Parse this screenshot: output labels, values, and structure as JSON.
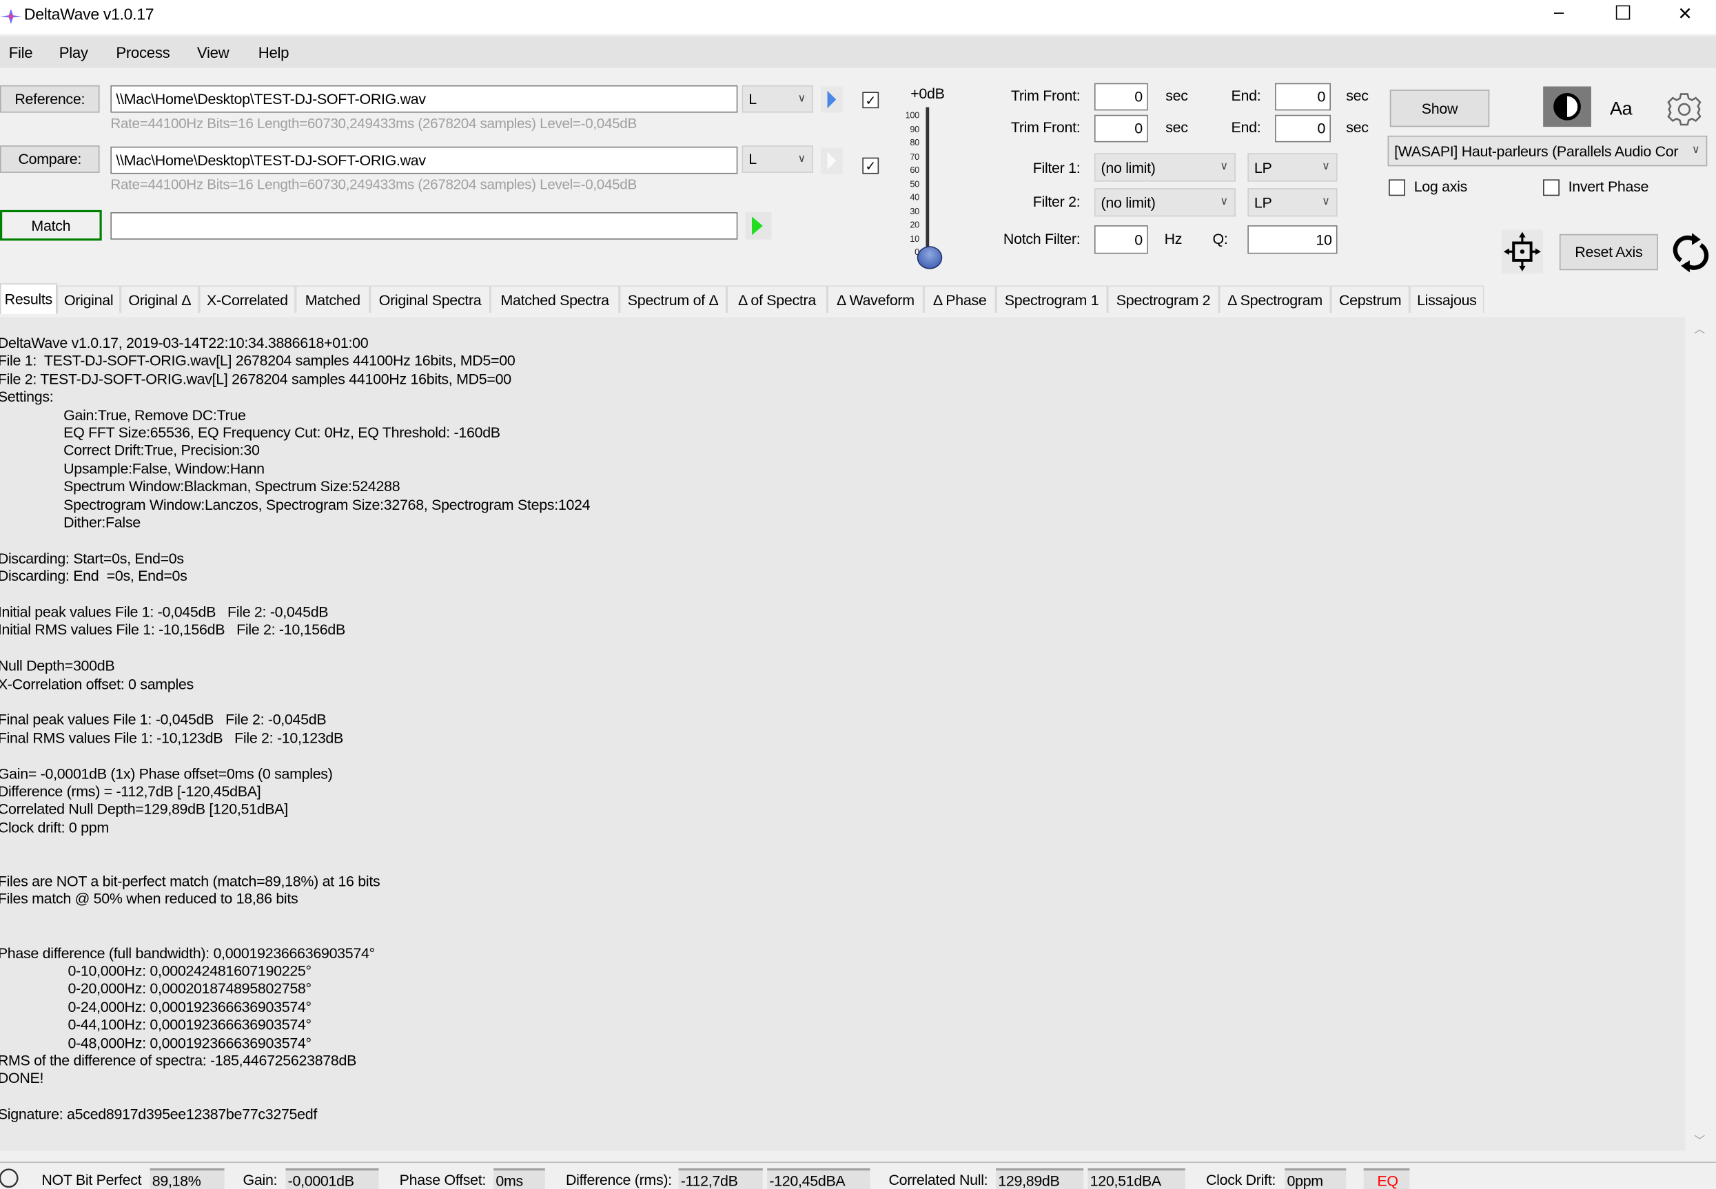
{
  "window": {
    "title": "DeltaWave v1.0.17",
    "minimize": "–",
    "maximize": "☐",
    "close": "✕"
  },
  "menu": [
    "File",
    "Play",
    "Process",
    "View",
    "Help"
  ],
  "reference": {
    "button": "Reference:",
    "path": "\\\\Mac\\Home\\Desktop\\TEST-DJ-SOFT-ORIG.wav",
    "channel": "L",
    "info": "Rate=44100Hz Bits=16 Length=60730,249433ms (2678204 samples) Level=-0,045dB",
    "checked": true
  },
  "compare": {
    "button": "Compare:",
    "path": "\\\\Mac\\Home\\Desktop\\TEST-DJ-SOFT-ORIG.wav",
    "channel": "L",
    "info": "Rate=44100Hz Bits=16 Length=60730,249433ms (2678204 samples) Level=-0,045dB",
    "checked": true
  },
  "match": {
    "button": "Match",
    "value": ""
  },
  "level": {
    "label": "+0dB",
    "ticks": [
      "100",
      "90",
      "80",
      "70",
      "60",
      "50",
      "40",
      "30",
      "20",
      "10",
      "0"
    ],
    "value": 0
  },
  "trim": [
    {
      "front_label": "Trim Front:",
      "front": "0",
      "unit": "sec",
      "end_label": "End:",
      "end": "0",
      "end_unit": "sec"
    },
    {
      "front_label": "Trim Front:",
      "front": "0",
      "unit": "sec",
      "end_label": "End:",
      "end": "0",
      "end_unit": "sec"
    }
  ],
  "filters": [
    {
      "label": "Filter 1:",
      "value": "(no limit)",
      "type": "LP"
    },
    {
      "label": "Filter 2:",
      "value": "(no limit)",
      "type": "LP"
    }
  ],
  "notch": {
    "label": "Notch Filter:",
    "value": "0",
    "unit": "Hz",
    "q_label": "Q:",
    "q": "10"
  },
  "right": {
    "show": "Show",
    "font": "Aa",
    "device": "[WASAPI] Haut-parleurs (Parallels Audio Cor",
    "log_axis": "Log axis",
    "invert_phase": "Invert Phase",
    "reset_axis": "Reset Axis"
  },
  "tabs": [
    "Results",
    "Original",
    "Original Δ",
    "X-Correlated",
    "Matched",
    "Original Spectra",
    "Matched Spectra",
    "Spectrum of Δ",
    "Δ of Spectra",
    "Δ Waveform",
    "Δ Phase",
    "Spectrogram 1",
    "Spectrogram 2",
    "Δ Spectrogram",
    "Cepstrum",
    "Lissajous"
  ],
  "results": [
    {
      "t": "DeltaWave v1.0.17, 2019-03-14T22:10:34.3886618+01:00",
      "i": 0
    },
    {
      "t": "File 1:  TEST-DJ-SOFT-ORIG.wav[L] 2678204 samples 44100Hz 16bits, MD5=00",
      "i": 0
    },
    {
      "t": "File 2: TEST-DJ-SOFT-ORIG.wav[L] 2678204 samples 44100Hz 16bits, MD5=00",
      "i": 0
    },
    {
      "t": "Settings:",
      "i": 0
    },
    {
      "t": "Gain:True, Remove DC:True",
      "i": 1
    },
    {
      "t": "EQ FFT Size:65536, EQ Frequency Cut: 0Hz, EQ Threshold: -160dB",
      "i": 1
    },
    {
      "t": "Correct Drift:True, Precision:30",
      "i": 1
    },
    {
      "t": "Upsample:False, Window:Hann",
      "i": 1
    },
    {
      "t": "Spectrum Window:Blackman, Spectrum Size:524288",
      "i": 1
    },
    {
      "t": "Spectrogram Window:Lanczos, Spectrogram Size:32768, Spectrogram Steps:1024",
      "i": 1
    },
    {
      "t": "Dither:False",
      "i": 1
    },
    {
      "t": "",
      "i": 0
    },
    {
      "t": "Discarding: Start=0s, End=0s",
      "i": 0
    },
    {
      "t": "Discarding: End  =0s, End=0s",
      "i": 0
    },
    {
      "t": "",
      "i": 0
    },
    {
      "t": "Initial peak values File 1: -0,045dB   File 2: -0,045dB",
      "i": 0
    },
    {
      "t": "Initial RMS values File 1: -10,156dB   File 2: -10,156dB",
      "i": 0
    },
    {
      "t": "",
      "i": 0
    },
    {
      "t": "Null Depth=300dB",
      "i": 0
    },
    {
      "t": "X-Correlation offset: 0 samples",
      "i": 0
    },
    {
      "t": "",
      "i": 0
    },
    {
      "t": "Final peak values File 1: -0,045dB   File 2: -0,045dB",
      "i": 0
    },
    {
      "t": "Final RMS values File 1: -10,123dB   File 2: -10,123dB",
      "i": 0
    },
    {
      "t": "",
      "i": 0
    },
    {
      "t": "Gain= -0,0001dB (1x) Phase offset=0ms (0 samples)",
      "i": 0
    },
    {
      "t": "Difference (rms) = -112,7dB [-120,45dBA]",
      "i": 0
    },
    {
      "t": "Correlated Null Depth=129,89dB [120,51dBA]",
      "i": 0
    },
    {
      "t": "Clock drift: 0 ppm",
      "i": 0
    },
    {
      "t": "",
      "i": 0
    },
    {
      "t": "",
      "i": 0
    },
    {
      "t": "Files are NOT a bit-perfect match (match=89,18%) at 16 bits",
      "i": 0
    },
    {
      "t": "Files match @ 50% when reduced to 18,86 bits",
      "i": 0
    },
    {
      "t": "",
      "i": 0
    },
    {
      "t": "",
      "i": 0
    },
    {
      "t": "Phase difference (full bandwidth): 0,000192366636903574°",
      "i": 0
    },
    {
      "t": "0-10,000Hz: 0,000242481607190225°",
      "i": 2
    },
    {
      "t": "0-20,000Hz: 0,000201874895802758°",
      "i": 2
    },
    {
      "t": "0-24,000Hz: 0,000192366636903574°",
      "i": 2
    },
    {
      "t": "0-44,100Hz: 0,000192366636903574°",
      "i": 2
    },
    {
      "t": "0-48,000Hz: 0,000192366636903574°",
      "i": 2
    },
    {
      "t": "RMS of the difference of spectra: -185,446725623878dB",
      "i": 0
    },
    {
      "t": "DONE!",
      "i": 0
    },
    {
      "t": "",
      "i": 0
    },
    {
      "t": "Signature: a5ced8917d395ee12387be77c3275edf",
      "i": 0
    }
  ],
  "status": {
    "bit_perfect_label": "NOT Bit Perfect",
    "bit_perfect": "89,18%",
    "gain_label": "Gain:",
    "gain": "-0,0001dB",
    "phase_label": "Phase Offset:",
    "phase": "0ms",
    "diff_label": "Difference (rms):",
    "diff_db": "-112,7dB",
    "diff_dba": "-120,45dBA",
    "null_label": "Correlated Null:",
    "null_db": "129,89dB",
    "null_dba": "120,51dBA",
    "drift_label": "Clock Drift:",
    "drift": "0ppm",
    "eq": "EQ"
  },
  "colors": {
    "match_border": "#008000",
    "play_ref": "#4a86e8",
    "play_match": "#22dd22",
    "eq": "#ff0000"
  }
}
